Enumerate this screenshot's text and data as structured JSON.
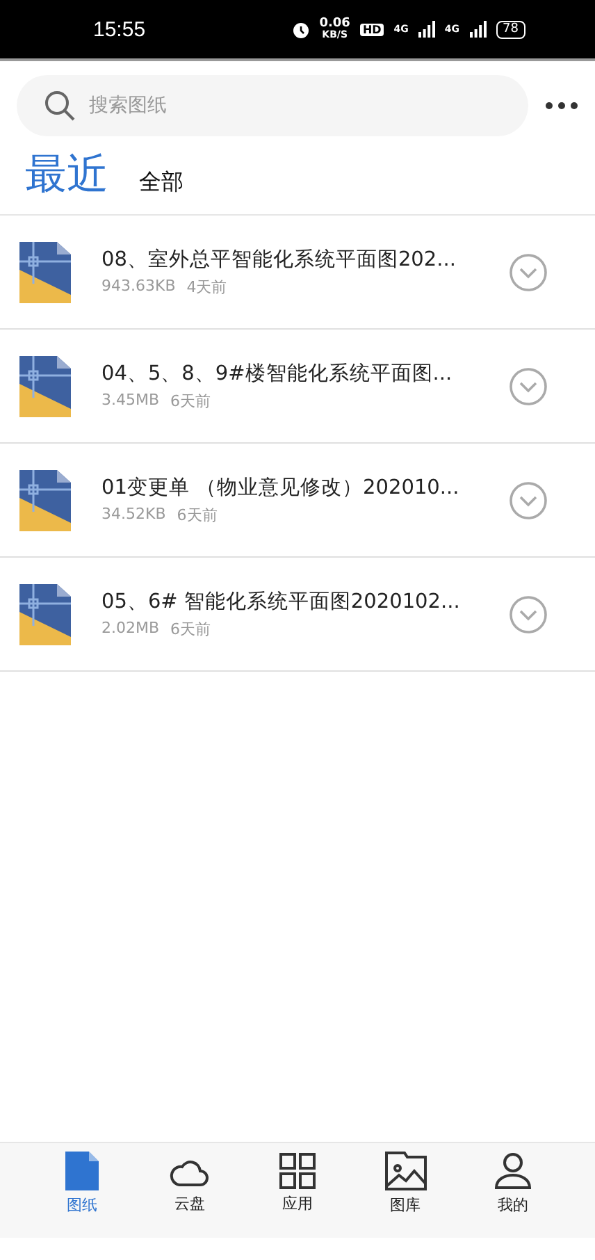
{
  "status_bar": {
    "time": "15:55",
    "speed": "0.06",
    "speed_unit": "KB/S",
    "hd": "HD",
    "network_1": "4G",
    "network_2": "4G",
    "battery": "78"
  },
  "search": {
    "placeholder": "搜索图纸"
  },
  "tabs": [
    {
      "label": "最近",
      "selected": true
    },
    {
      "label": "全部",
      "selected": false
    }
  ],
  "files": [
    {
      "name": "08、室外总平智能化系统平面图202...",
      "size": "943.63KB",
      "age": "4天前"
    },
    {
      "name": "04、5、8、9#楼智能化系统平面图...",
      "size": "3.45MB",
      "age": "6天前"
    },
    {
      "name": "01变更单 （物业意见修改）202010...",
      "size": "34.52KB",
      "age": "6天前"
    },
    {
      "name": "05、6# 智能化系统平面图2020102...",
      "size": "2.02MB",
      "age": "6天前"
    }
  ],
  "nav": [
    {
      "kind": "drawings",
      "label": "图纸",
      "selected": true
    },
    {
      "kind": "cloud",
      "label": "云盘",
      "selected": false
    },
    {
      "kind": "apps",
      "label": "应用",
      "selected": false
    },
    {
      "kind": "gallery",
      "label": "图库",
      "selected": false
    },
    {
      "kind": "me",
      "label": "我的",
      "selected": false
    }
  ]
}
